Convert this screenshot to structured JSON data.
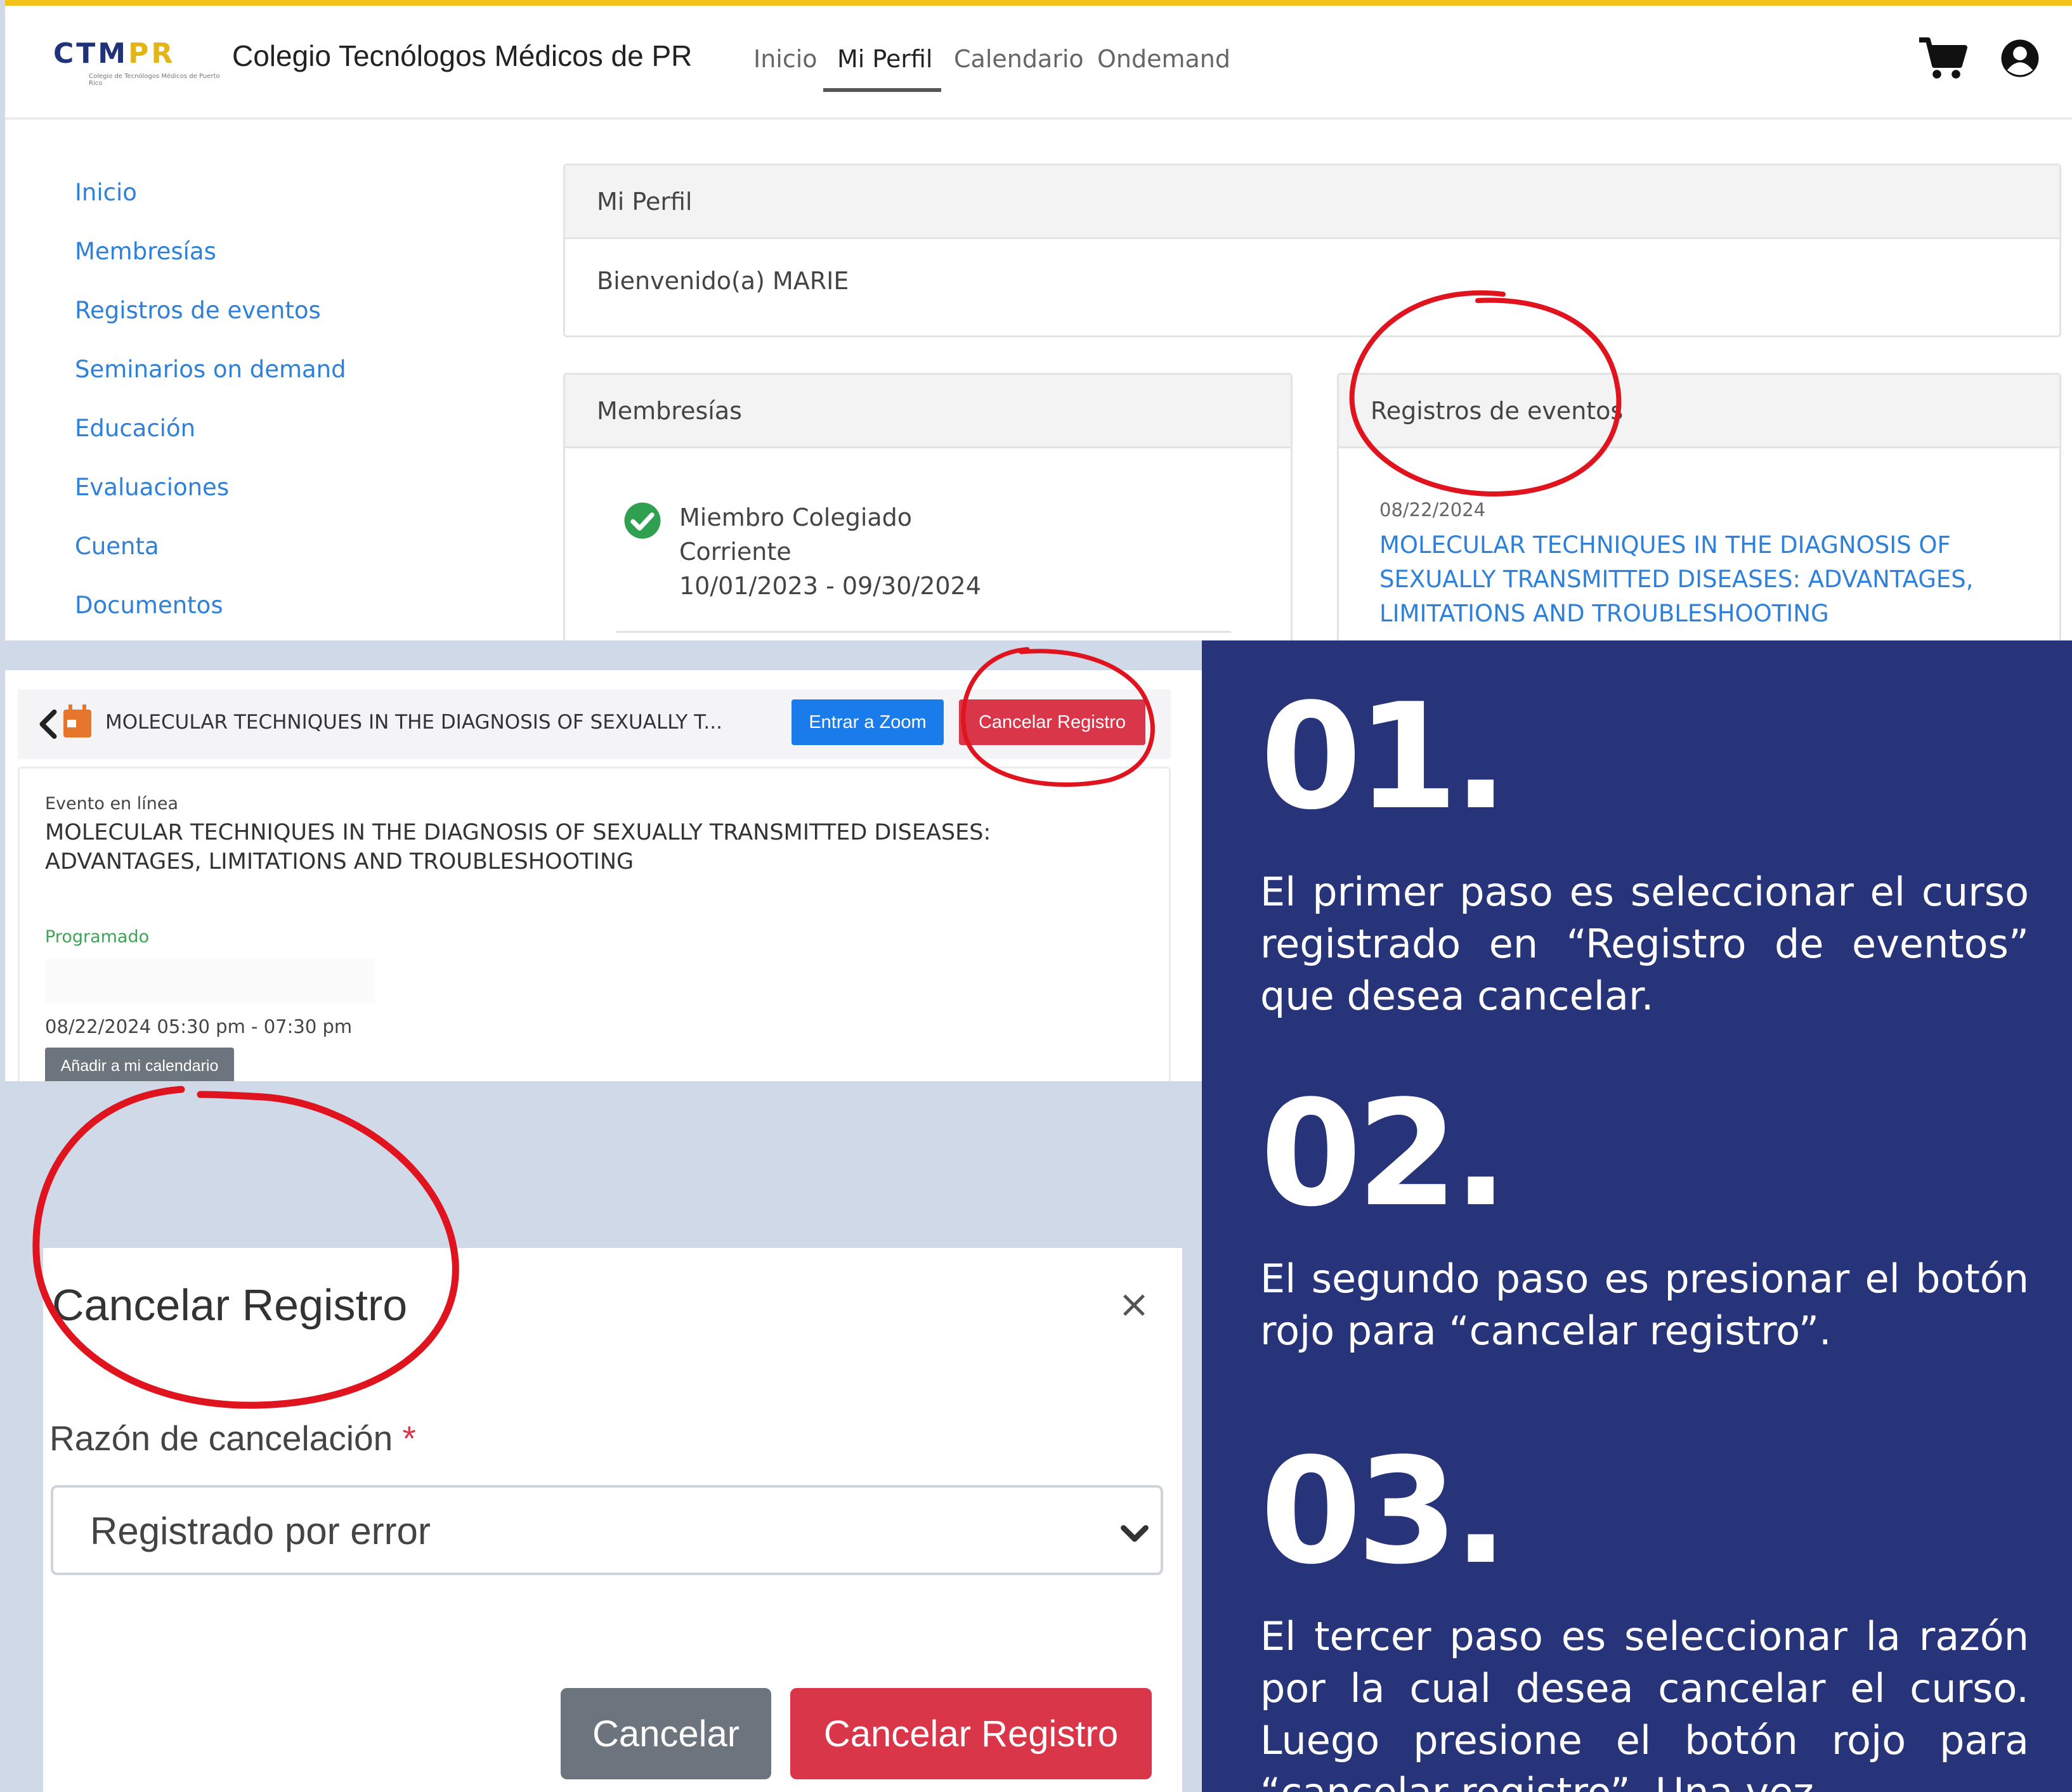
{
  "colors": {
    "accent_gold": "#f3c21b",
    "link_blue": "#2f80d8",
    "zoom_blue": "#1a7bea",
    "danger_red": "#d9364a",
    "secondary_gray": "#6c757d",
    "instructions_bg": "#283479",
    "annotation_red": "#e0141e"
  },
  "header": {
    "logo_text_a": "CTM",
    "logo_text_b": "PR",
    "logo_subtitle": "Colegio de Tecnólogos Médicos de Puerto Rico",
    "site_title": "Colegio Tecnólogos Médicos de PR",
    "nav": [
      "Inicio",
      "Mi Perfil",
      "Calendario",
      "Ondemand"
    ],
    "cart_icon": "shopping-cart-icon",
    "user_icon": "user-circle-icon"
  },
  "sidebar": {
    "items": [
      "Inicio",
      "Membresías",
      "Registros de eventos",
      "Seminarios on demand",
      "Educación",
      "Evaluaciones",
      "Cuenta",
      "Documentos"
    ]
  },
  "profile_card": {
    "title": "Mi Perfil",
    "welcome": "Bienvenido(a) MARIE"
  },
  "membership_card": {
    "title": "Membresías",
    "status_icon": "check-circle-icon",
    "line1": "Miembro Colegiado",
    "line2": "Corriente",
    "line3": "10/01/2023 - 09/30/2024"
  },
  "events_card": {
    "title": "Registros de eventos",
    "date": "08/22/2024",
    "link": "MOLECULAR TECHNIQUES IN THE DIAGNOSIS OF SEXUALLY TRANSMITTED DISEASES: ADVANTAGES, LIMITATIONS AND TROUBLESHOOTING"
  },
  "event_detail": {
    "header_title": "MOLECULAR TECHNIQUES IN THE DIAGNOSIS OF SEXUALLY T...",
    "zoom_button": "Entrar a Zoom",
    "cancel_button": "Cancelar Registro",
    "type": "Evento en línea",
    "title": "MOLECULAR TECHNIQUES IN THE DIAGNOSIS OF SEXUALLY TRANSMITTED DISEASES: ADVANTAGES, LIMITATIONS AND TROUBLESHOOTING",
    "status": "Programado",
    "datetime": "08/22/2024 05:30 pm - 07:30 pm",
    "add_calendar_button": "Añadir a mi calendario"
  },
  "modal": {
    "title": "Cancelar Registro",
    "close_symbol": "×",
    "reason_label": "Razón de cancelación",
    "required_mark": "*",
    "reason_value": "Registrado por error",
    "cancel_button": "Cancelar",
    "confirm_button": "Cancelar Registro"
  },
  "instructions": {
    "steps": [
      {
        "number": "01.",
        "text": "El primer paso es seleccionar el curso registrado en “Registro de eventos” que desea cancelar."
      },
      {
        "number": "02.",
        "text": "El segundo paso es presionar el botón rojo para “cancelar registro”."
      },
      {
        "number": "03.",
        "text": "El tercer paso es seleccionar la razón por la cual desea cancelar el curso. Luego presione el botón rojo para “cancelar registro”. Una vez"
      }
    ]
  }
}
